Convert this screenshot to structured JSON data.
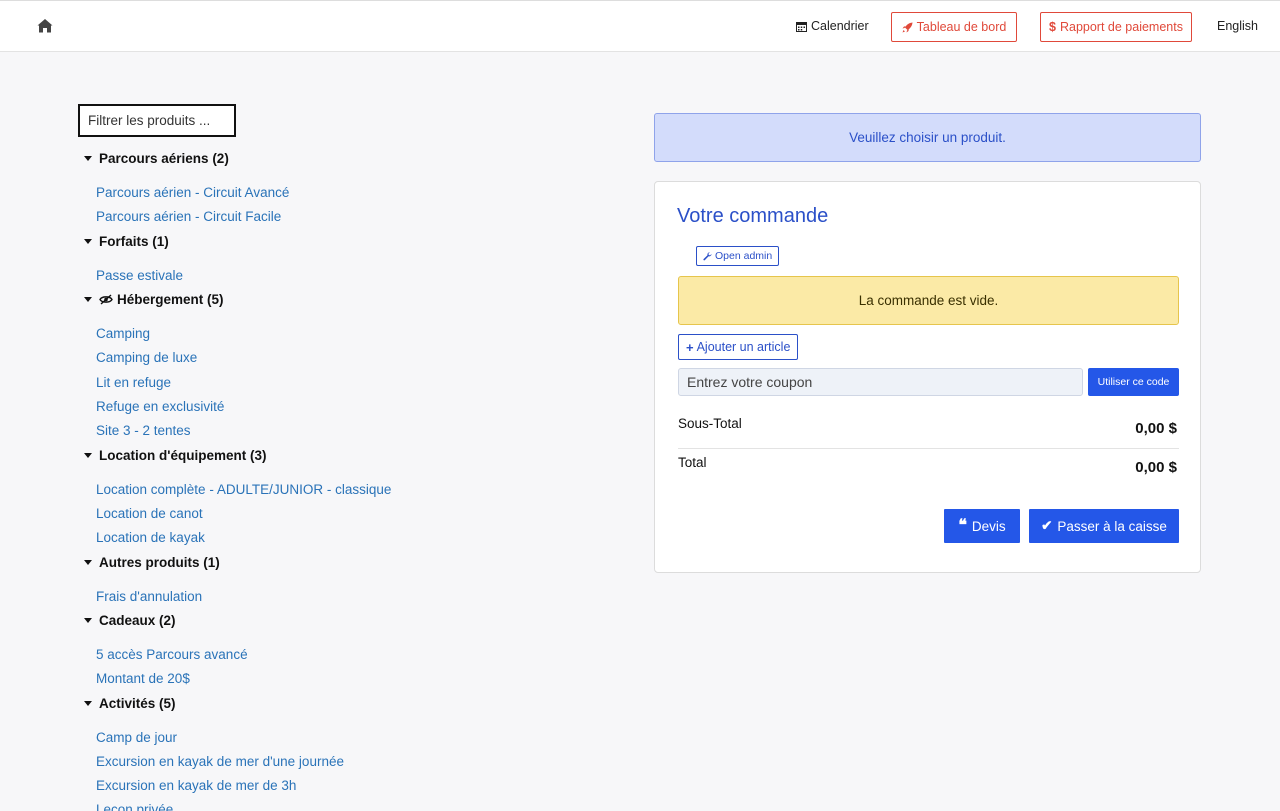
{
  "nav": {
    "home_icon": "home-icon",
    "calendar_label": "Calendrier",
    "dashboard_label": "Tableau de bord",
    "payments_label": "Rapport de paiements",
    "language_label": "English",
    "accent_color": "#e0493a"
  },
  "filter": {
    "placeholder": "Filtrer les produits ..."
  },
  "categories": [
    {
      "label": "Parcours aériens (2)",
      "items": [
        "Parcours aérien - Circuit Avancé",
        "Parcours aérien - Circuit Facile"
      ]
    },
    {
      "label": "Forfaits (1)",
      "items": [
        "Passe estivale"
      ]
    },
    {
      "label": "Hébergement (5)",
      "hidden_icon": "eye-slash-icon",
      "items": [
        "Camping",
        "Camping de luxe",
        "Lit en refuge",
        "Refuge en exclusivité",
        "Site 3 - 2 tentes"
      ]
    },
    {
      "label": "Location d'équipement (3)",
      "items": [
        "Location complète - ADULTE/JUNIOR - classique",
        "Location de canot",
        "Location de kayak"
      ]
    },
    {
      "label": "Autres produits (1)",
      "items": [
        "Frais d'annulation"
      ]
    },
    {
      "label": "Cadeaux (2)",
      "items": [
        "5 accès Parcours avancé",
        "Montant de 20$"
      ]
    },
    {
      "label": "Activités (5)",
      "items": [
        "Camp de jour",
        "Excursion en kayak de mer d'une journée",
        "Excursion en kayak de mer de 3h",
        "Leçon privée"
      ]
    }
  ],
  "info_message": "Veuillez choisir un produit.",
  "order": {
    "title": "Votre commande",
    "open_admin_label": "Open admin",
    "empty_message": "La commande est vide.",
    "add_item_label": "Ajouter un article",
    "coupon_placeholder": "Entrez votre coupon",
    "coupon_button": "Utiliser ce code",
    "subtotal_label": "Sous-Total",
    "subtotal_value": "0,00 $",
    "total_label": "Total",
    "total_value": "0,00 $",
    "quote_label": "Devis",
    "checkout_label": "Passer à la caisse",
    "primary_color": "#2457e8"
  }
}
